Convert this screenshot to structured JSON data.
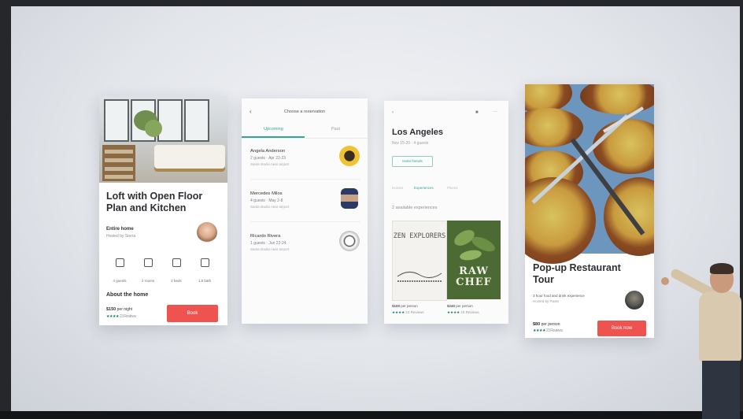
{
  "listing": {
    "title": "Loft with Open Floor Plan and Kitchen",
    "type": "Entire home",
    "host": "Hosted by Sierra",
    "amenities": [
      "4 guests",
      "2 rooms",
      "2 beds",
      "1.5 bath"
    ],
    "about_heading": "About the home",
    "price": "$150",
    "price_unit": "per night",
    "stars": "★★★★",
    "reviews": "23 Reviews",
    "button": "Book"
  },
  "reservations": {
    "header": "Choose a reservation",
    "tabs": [
      "Upcoming",
      "Past"
    ],
    "items": [
      {
        "name": "Angela Anderson",
        "detail": "2 guests · Apr 22-23",
        "note": "Santa studio near airport"
      },
      {
        "name": "Mercedes Milos",
        "detail": "4 guests · May 2-8",
        "note": "Santa studio near airport"
      },
      {
        "name": "Ricardo Rivera",
        "detail": "1 guests · Jun 22-24",
        "note": "Santa studio near airport"
      }
    ]
  },
  "trip": {
    "city": "Los Angeles",
    "dates": "Nov 15-20 · 4 guests",
    "pill": "Invite friends",
    "tabs": [
      "Homes",
      "Experiences",
      "Places"
    ],
    "available": "2 available experiences",
    "books": [
      {
        "cover": "ZEN EXPLORERS",
        "price": "$100",
        "unit": "per person",
        "stars": "★★★★",
        "reviews": "23 Reviews"
      },
      {
        "cover": "RAW CHEF",
        "price": "$240",
        "unit": "per person",
        "stars": "★★★★",
        "reviews": "18 Reviews"
      }
    ]
  },
  "experience": {
    "title": "Pop-up Restaurant Tour",
    "desc": "3 hour food and drink experience",
    "host": "Hosted by Paolo",
    "price": "$80",
    "price_unit": "per person",
    "stars": "★★★★",
    "reviews": "23 Reviews",
    "button": "Book now"
  },
  "colors": {
    "accent_red": "#ef5350",
    "accent_teal": "#33a595"
  }
}
